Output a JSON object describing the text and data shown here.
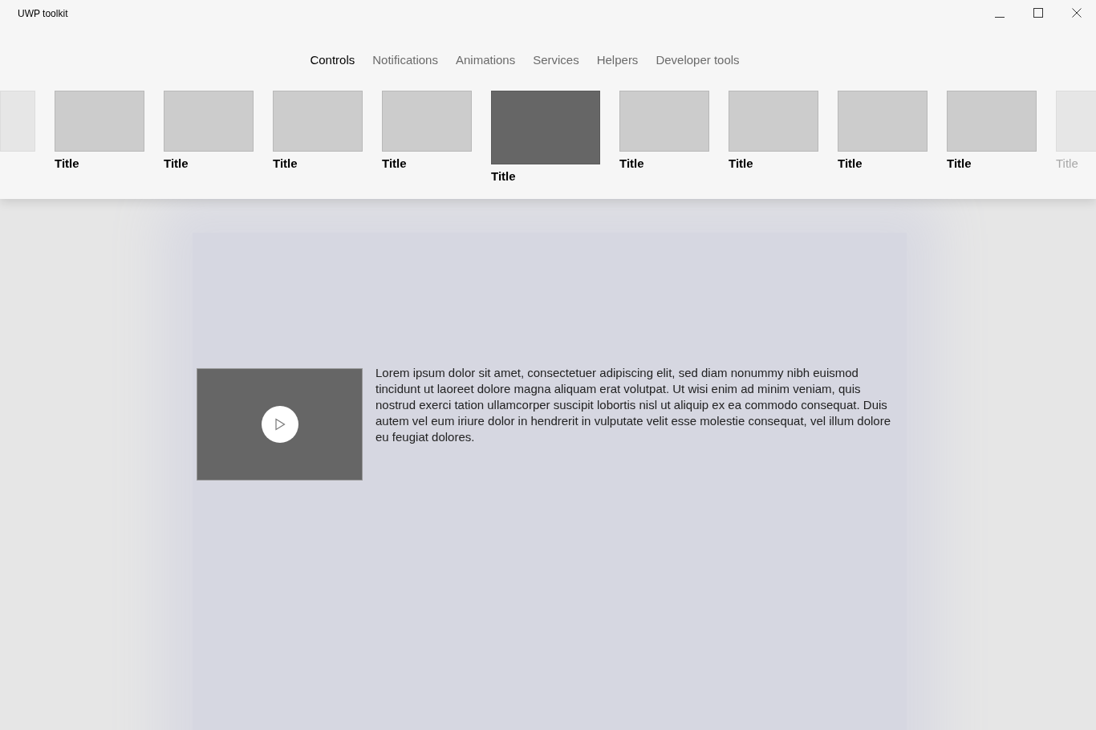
{
  "window": {
    "title": "UWP toolkit"
  },
  "tabs": [
    {
      "label": "Controls",
      "selected": true
    },
    {
      "label": "Notifications",
      "selected": false
    },
    {
      "label": "Animations",
      "selected": false
    },
    {
      "label": "Services",
      "selected": false
    },
    {
      "label": "Helpers",
      "selected": false
    },
    {
      "label": "Developer tools",
      "selected": false
    }
  ],
  "carousel": [
    {
      "selected": false,
      "faded": true
    },
    {
      "title": "Title",
      "selected": false,
      "faded": false
    },
    {
      "title": "Title",
      "selected": false,
      "faded": false
    },
    {
      "title": "Title",
      "selected": false,
      "faded": false
    },
    {
      "title": "Title",
      "selected": false,
      "faded": false
    },
    {
      "title": "Title",
      "selected": true,
      "faded": false
    },
    {
      "title": "Title",
      "selected": false,
      "faded": false
    },
    {
      "title": "Title",
      "selected": false,
      "faded": false
    },
    {
      "title": "Title",
      "selected": false,
      "faded": false
    },
    {
      "title": "Title",
      "selected": false,
      "faded": false
    },
    {
      "title": "Title",
      "selected": false,
      "faded": true
    }
  ],
  "article": {
    "text": "Lorem ipsum dolor sit amet, consectetuer adipiscing elit, sed diam nonummy nibh euismod tincidunt ut laoreet dolore magna aliquam erat volutpat. Ut wisi enim ad minim veniam, quis nostrud exerci tation ullamcorper suscipit lobortis nisl ut aliquip ex ea commodo consequat. Duis autem vel eum iriure dolor in hendrerit in vulputate velit esse molestie consequat, vel illum dolore eu feugiat dolores."
  }
}
